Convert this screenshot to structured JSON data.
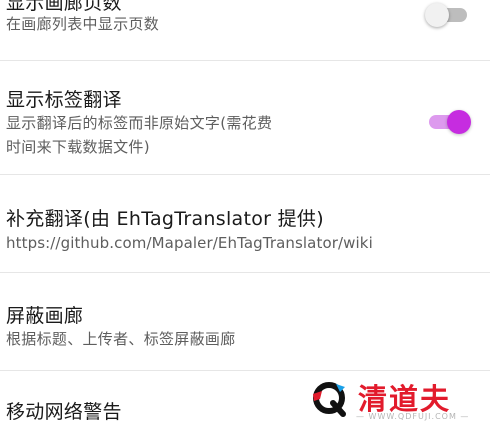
{
  "settings": {
    "show_page_count": {
      "title": "显示画廊页数",
      "summary": "在画廊列表中显示页数",
      "enabled": false
    },
    "tag_translation": {
      "title": "显示标签翻译",
      "summary_line1": "显示翻译后的标签而非原始文字(需花费",
      "summary_line2": "时间来下载数据文件)",
      "enabled": true
    },
    "supplement_translation": {
      "title": "补充翻译(由 EhTagTranslator 提供)",
      "summary": "https://github.com/Mapaler/EhTagTranslator/wiki"
    },
    "block_gallery": {
      "title": "屏蔽画廊",
      "summary": "根据标题、上传者、标签屏蔽画廊"
    },
    "mobile_network_warning": {
      "title": "移动网络警告"
    }
  },
  "watermark": {
    "brand": "清道夫",
    "url": "— WWW.QDFUJI.COM —"
  },
  "colors": {
    "accent": "#c62ce0",
    "accent_track": "#dd9aee",
    "switch_off_track": "#bdbdbd",
    "watermark_red": "#e21b2c"
  }
}
